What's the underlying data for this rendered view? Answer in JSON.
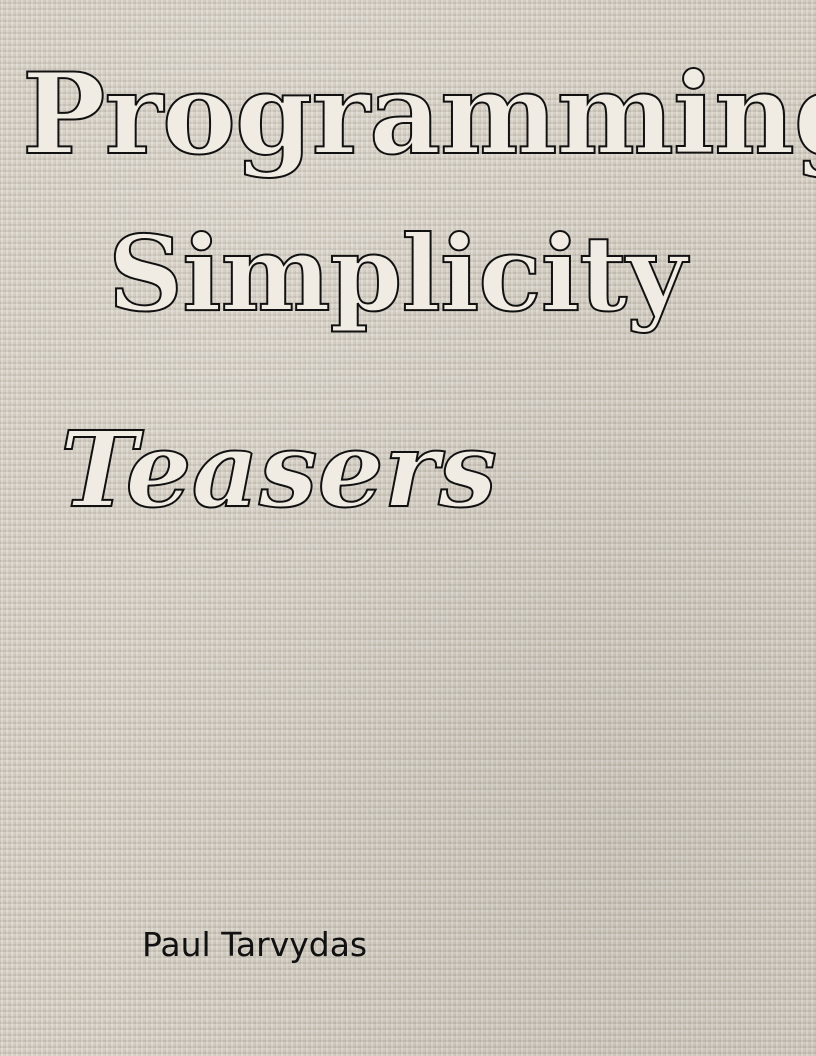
{
  "cover": {
    "title_lines": [
      "Programming",
      "Simplicity",
      "Teasers"
    ],
    "author": "Paul Tarvydas"
  }
}
